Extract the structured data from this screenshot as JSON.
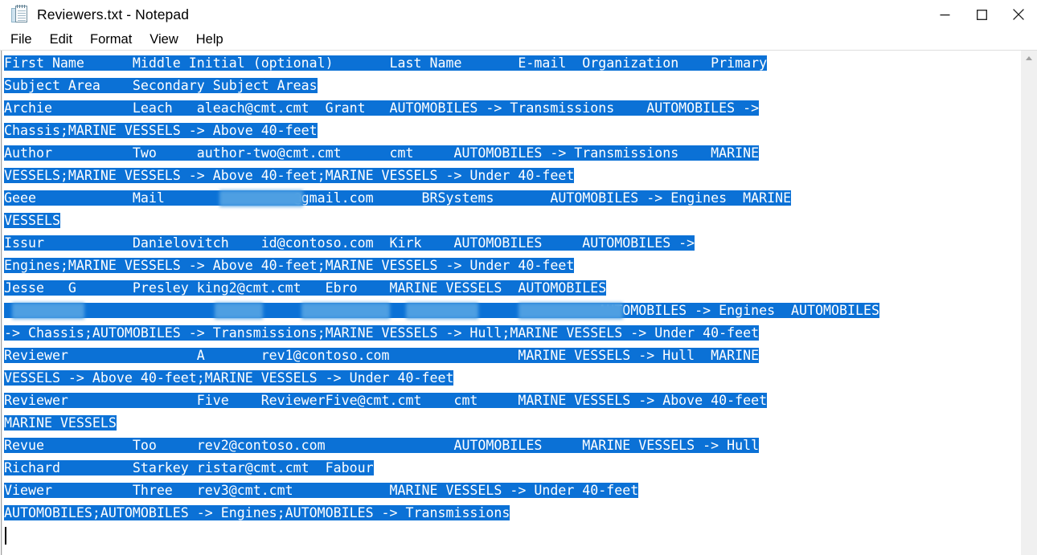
{
  "window": {
    "title": "Reviewers.txt - Notepad",
    "app_icon": "notepad-icon",
    "controls": {
      "minimize": "minimize-icon",
      "maximize": "maximize-icon",
      "close": "close-icon"
    }
  },
  "menu": {
    "items": [
      {
        "label": "File"
      },
      {
        "label": "Edit"
      },
      {
        "label": "Format"
      },
      {
        "label": "View"
      },
      {
        "label": "Help"
      }
    ]
  },
  "scrollbar": {
    "up_arrow": "scroll-up-arrow-icon"
  },
  "document": {
    "selection_color": "#0b71d6",
    "selection_text_color": "#ffffff",
    "lines": [
      {
        "id": 1,
        "selected_text": "First Name      Middle Initial (optional)       Last Name       E-mail  Organization    Primary",
        "trailing_blank_selected": false
      },
      {
        "id": 2,
        "selected_text": "Subject Area    Secondary Subject Areas",
        "trailing_blank_selected": false
      },
      {
        "id": 3,
        "selected_text": "Archie          Leach   aleach@cmt.cmt  Grant   AUTOMOBILES -> Transmissions    AUTOMOBILES ->",
        "trailing_blank_selected": false
      },
      {
        "id": 4,
        "selected_text": "Chassis;MARINE VESSELS -> Above 40-feet",
        "trailing_blank_selected": false
      },
      {
        "id": 5,
        "selected_text": "Author          Two     author-two@cmt.cmt      cmt     AUTOMOBILES -> Transmissions    MARINE",
        "trailing_blank_selected": false
      },
      {
        "id": 6,
        "selected_text": "VESSELS;MARINE VESSELS -> Above 40-feet;MARINE VESSELS -> Under 40-feet",
        "trailing_blank_selected": false
      },
      {
        "id": 7,
        "prefix": "Geee            Mail    ",
        "redacted": true,
        "suffix": "@gmail.com      BRSystems       AUTOMOBILES -> Engines  MARINE",
        "trailing_blank_selected": false
      },
      {
        "id": 8,
        "selected_text": "VESSELS",
        "trailing_blank_selected": false
      },
      {
        "id": 9,
        "selected_text": "Issur           Danielovitch    id@contoso.com  Kirk    AUTOMOBILES     AUTOMOBILES ->",
        "trailing_blank_selected": false
      },
      {
        "id": 10,
        "selected_text": "Engines;MARINE VESSELS -> Above 40-feet;MARINE VESSELS -> Under 40-feet",
        "trailing_blank_selected": false
      },
      {
        "id": 11,
        "selected_text": "Jesse   G       Presley king2@cmt.cmt   Ebro    MARINE VESSELS  AUTOMOBILES",
        "trailing_blank_selected": false
      },
      {
        "id": 12,
        "redacted_row": true,
        "suffix": "AUTOMOBILES -> Engines  AUTOMOBILES",
        "trailing_blank_selected": false
      },
      {
        "id": 13,
        "selected_text": "-> Chassis;AUTOMOBILES -> Transmissions;MARINE VESSELS -> Hull;MARINE VESSELS -> Under 40-feet",
        "trailing_blank_selected": false
      },
      {
        "id": 14,
        "selected_text": "Reviewer                A       rev1@contoso.com                MARINE VESSELS -> Hull  MARINE",
        "trailing_blank_selected": false
      },
      {
        "id": 15,
        "selected_text": "VESSELS -> Above 40-feet;MARINE VESSELS -> Under 40-feet",
        "trailing_blank_selected": false
      },
      {
        "id": 16,
        "selected_text": "Reviewer                Five    ReviewerFive@cmt.cmt    cmt     MARINE VESSELS -> Above 40-feet",
        "trailing_blank_selected": false
      },
      {
        "id": 17,
        "selected_text": "MARINE VESSELS",
        "trailing_blank_selected": false
      },
      {
        "id": 18,
        "selected_text": "Revue           Too     rev2@contoso.com                AUTOMOBILES     MARINE VESSELS -> Hull",
        "trailing_blank_selected": false
      },
      {
        "id": 19,
        "selected_text": "Richard         Starkey ristar@cmt.cmt  Fabour",
        "trailing_blank_selected": false
      },
      {
        "id": 20,
        "selected_text": "Viewer          Three   rev3@cmt.cmt            MARINE VESSELS -> Under 40-feet",
        "trailing_blank_selected": false
      },
      {
        "id": 21,
        "selected_text": "AUTOMOBILES;AUTOMOBILES -> Engines;AUTOMOBILES -> Transmissions",
        "trailing_blank_selected": false
      },
      {
        "id": 22,
        "selected_text": "",
        "caret": true,
        "trailing_blank_selected": false
      }
    ]
  }
}
